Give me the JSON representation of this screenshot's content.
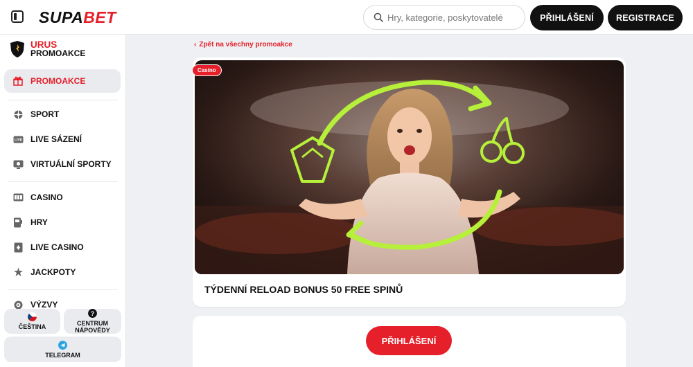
{
  "header": {
    "logo_prefix": "SUPA",
    "logo_suffix": "BET",
    "search_placeholder": "Hry, kategorie, poskytovatelé",
    "login_label": "PŘIHLÁŠENÍ",
    "register_label": "REGISTRACE"
  },
  "sidebar": {
    "brand_line1": "URUS",
    "brand_line2": "PROMOAKCE",
    "items": [
      {
        "label": "PROMOAKCE",
        "icon": "gift-icon"
      },
      {
        "label": "SPORT",
        "icon": "ball-icon"
      },
      {
        "label": "LIVE SÁZENÍ",
        "icon": "live-icon"
      },
      {
        "label": "VIRTUÁLNÍ SPORTY",
        "icon": "virtual-icon"
      },
      {
        "label": "CASINO",
        "icon": "slots-icon"
      },
      {
        "label": "HRY",
        "icon": "games-icon"
      },
      {
        "label": "LIVE CASINO",
        "icon": "cards-icon"
      },
      {
        "label": "JACKPOTY",
        "icon": "jackpot-icon"
      },
      {
        "label": "VÝZVY",
        "icon": "challenge-icon"
      }
    ],
    "language_label": "ČEŠTINA",
    "help_label": "CENTRUM NÁPOVĚDY",
    "telegram_label": "TELEGRAM"
  },
  "main": {
    "back_link": "Zpět na všechny promoakce",
    "promo_badge": "Casino",
    "promo_title": "TÝDENNÍ RELOAD BONUS 50 FREE SPINŮ",
    "login_button": "PŘIHLÁŠENÍ"
  },
  "colors": {
    "accent": "#e5202a",
    "dark_button": "#111111",
    "neon_arrow": "#b6f03a"
  }
}
